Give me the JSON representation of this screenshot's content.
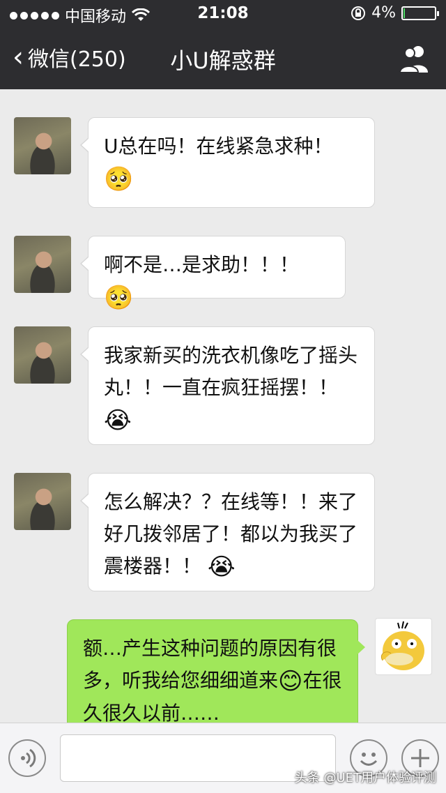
{
  "status_bar": {
    "carrier": "中国移动",
    "time": "21:08",
    "battery": "4%",
    "battery_level": 0.04
  },
  "nav": {
    "back_label": "微信(250)",
    "title": "小U解惑群"
  },
  "messages": [
    {
      "side": "left",
      "text": "U总在吗！在线紧急求种！",
      "emoji": "🥺"
    },
    {
      "side": "left",
      "text": "啊不是…是求助！！！",
      "emoji": "🥺"
    },
    {
      "side": "left",
      "text": "我家新买的洗衣机像吃了摇头丸！！一直在疯狂摇摆！！",
      "emoji": "😭"
    },
    {
      "side": "left",
      "text": "怎么解决？？在线等！！来了好几拨邻居了！都以为我买了震楼器！！",
      "emoji": "😭"
    },
    {
      "side": "right",
      "text_before": "额…产生这种问题的原因有很多，听我给您细细道来",
      "emoji": "😊",
      "text_after": "在很久很久以前……"
    }
  ],
  "input_bar": {
    "voice_icon": "voice-icon",
    "emoji_icon": "smiley-icon",
    "plus_icon": "plus-icon"
  },
  "watermark": "头条 @UET用户体验评测"
}
